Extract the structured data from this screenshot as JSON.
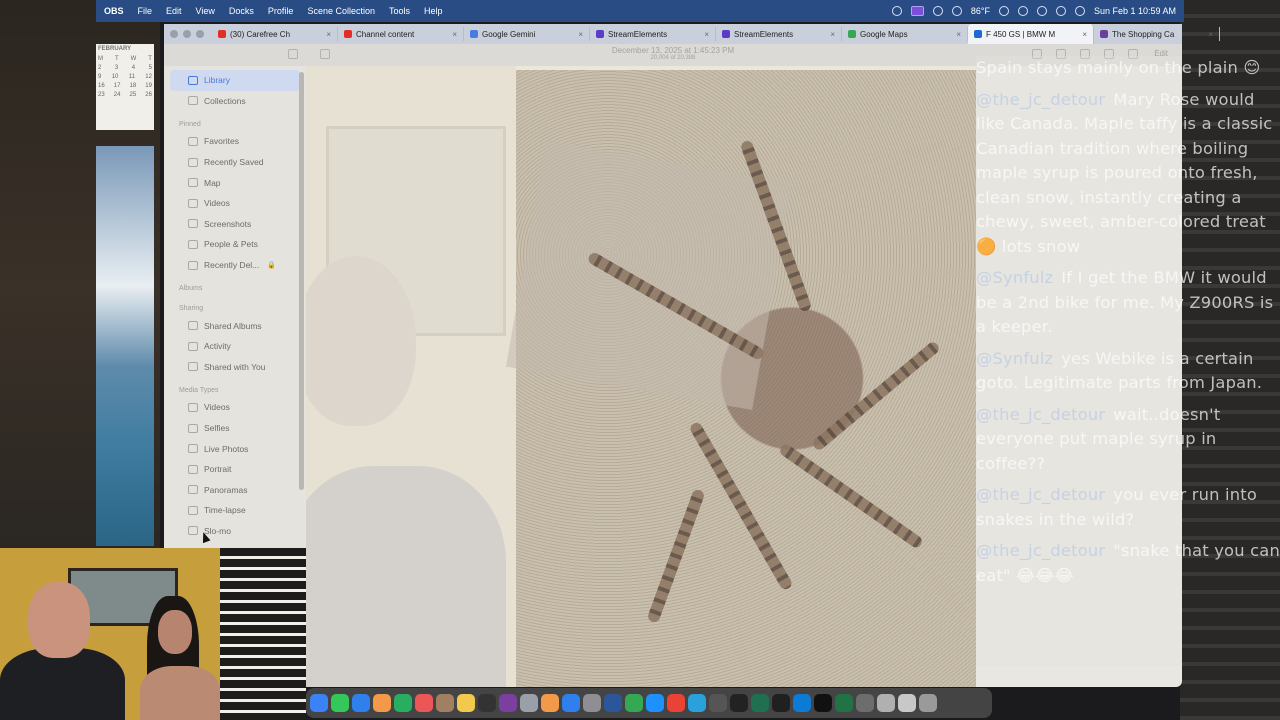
{
  "menubar": {
    "app": "OBS",
    "items": [
      "File",
      "Edit",
      "View",
      "Docks",
      "Profile",
      "Scene Collection",
      "Tools",
      "Help"
    ],
    "weather": "86°F",
    "datetime": "Sun Feb 1  10:59 AM",
    "accent": "#2a4c84"
  },
  "browser": {
    "tabs": [
      {
        "label": "(30) Carefree Ch",
        "icon": "youtube-icon",
        "color": "#e52d27"
      },
      {
        "label": "Channel content",
        "icon": "youtube-icon",
        "color": "#e52d27"
      },
      {
        "label": "Google Gemini",
        "icon": "gemini-icon",
        "color": "#4a7be0"
      },
      {
        "label": "StreamElements",
        "icon": "streamelements-icon",
        "color": "#5b3cc4"
      },
      {
        "label": "StreamElements",
        "icon": "streamelements-icon",
        "color": "#5b3cc4"
      },
      {
        "label": "Google Maps",
        "icon": "maps-icon",
        "color": "#34a853"
      },
      {
        "label": "F 450 GS | BMW M",
        "icon": "bmw-icon",
        "color": "#1c69d4"
      },
      {
        "label": "The Shopping Ca",
        "icon": "shop-icon",
        "color": "#6b3fa0"
      }
    ]
  },
  "photos": {
    "title": "December 13, 2025 at 1:45:23 PM",
    "subtitle": "20,004 of 20,388",
    "edit_label": "Edit",
    "sidebar": {
      "top": [
        {
          "label": "Library",
          "icon": "library-icon",
          "active": true
        },
        {
          "label": "Collections",
          "icon": "collections-icon"
        }
      ],
      "pinned_header": "Pinned",
      "pinned": [
        {
          "label": "Favorites",
          "icon": "heart-icon"
        },
        {
          "label": "Recently Saved",
          "icon": "clock-icon"
        },
        {
          "label": "Map",
          "icon": "map-icon"
        },
        {
          "label": "Videos",
          "icon": "video-icon"
        },
        {
          "label": "Screenshots",
          "icon": "screenshot-icon"
        },
        {
          "label": "People & Pets",
          "icon": "person-icon"
        },
        {
          "label": "Recently Del...",
          "icon": "trash-icon",
          "locked": true
        }
      ],
      "albums_header": "Albums",
      "sharing_header": "Sharing",
      "sharing": [
        {
          "label": "Shared Albums",
          "icon": "shared-albums-icon"
        },
        {
          "label": "Activity",
          "icon": "activity-icon"
        },
        {
          "label": "Shared with You",
          "icon": "shared-with-you-icon"
        }
      ],
      "media_header": "Media Types",
      "media": [
        {
          "label": "Videos",
          "icon": "video-icon"
        },
        {
          "label": "Selfies",
          "icon": "selfie-icon"
        },
        {
          "label": "Live Photos",
          "icon": "live-photo-icon"
        },
        {
          "label": "Portrait",
          "icon": "portrait-icon"
        },
        {
          "label": "Panoramas",
          "icon": "panorama-icon"
        },
        {
          "label": "Time-lapse",
          "icon": "timelapse-icon"
        },
        {
          "label": "Slo-mo",
          "icon": "slomo-icon"
        }
      ]
    }
  },
  "calendar": {
    "month": "FEBRUARY",
    "weekdays": [
      "M",
      "T",
      "W",
      "T"
    ],
    "rows": [
      [
        "2",
        "3",
        "4",
        "5"
      ],
      [
        "9",
        "10",
        "11",
        "12"
      ],
      [
        "16",
        "17",
        "18",
        "19"
      ],
      [
        "23",
        "24",
        "25",
        "26"
      ]
    ]
  },
  "chat": [
    {
      "user": "",
      "text": "Spain stays mainly on the plain 😊"
    },
    {
      "user": "@the_jc_detour",
      "text": "Mary Rose would like Canada. Maple taffy is a classic Canadian tradition where boiling maple syrup is poured onto fresh, clean snow, instantly creating a chewy, sweet, amber-colored treat 🟠 lots snow"
    },
    {
      "user": "@Synfulz",
      "text": "If I get the BMW it would be a 2nd bike for me. My Z900RS is a keeper."
    },
    {
      "user": "@Synfulz",
      "text": "yes Webike is a certain goto. Legitimate parts from Japan."
    },
    {
      "user": "@the_jc_detour",
      "text": "wait..doesn't everyone put maple syrup in coffee??"
    },
    {
      "user": "@the_jc_detour",
      "text": "you ever run into snakes in the wild?"
    },
    {
      "user": "@the_jc_detour",
      "text": "\"snake that you can eat\" 😂😂😂"
    }
  ],
  "dock": [
    {
      "icon": "finder-icon",
      "color": "#3b82f6"
    },
    {
      "icon": "messages-icon",
      "color": "#34c759"
    },
    {
      "icon": "mail-icon",
      "color": "#2f80ed"
    },
    {
      "icon": "photos-icon",
      "color": "#f2994a"
    },
    {
      "icon": "facetime-icon",
      "color": "#27ae60"
    },
    {
      "icon": "calendar-icon",
      "color": "#eb5757"
    },
    {
      "icon": "contacts-icon",
      "color": "#a08060"
    },
    {
      "icon": "notes-icon",
      "color": "#f2c94c"
    },
    {
      "icon": "obs-icon",
      "color": "#333333"
    },
    {
      "icon": "onenote-icon",
      "color": "#7b3fa0"
    },
    {
      "icon": "preview-icon",
      "color": "#9aa0aa"
    },
    {
      "icon": "pages-icon",
      "color": "#f2994a"
    },
    {
      "icon": "appstore-icon",
      "color": "#2f80ed"
    },
    {
      "icon": "settings-icon",
      "color": "#8e8e93"
    },
    {
      "icon": "word-icon",
      "color": "#2b579a"
    },
    {
      "icon": "maps-icon",
      "color": "#34a853"
    },
    {
      "icon": "safari-icon",
      "color": "#1e90ff"
    },
    {
      "icon": "chrome-icon",
      "color": "#ea4335"
    },
    {
      "icon": "telegram-icon",
      "color": "#2aa1da"
    },
    {
      "icon": "camera-icon",
      "color": "#555555"
    },
    {
      "icon": "clapper-icon",
      "color": "#222222"
    },
    {
      "icon": "terminal-icon",
      "color": "#1f6f50"
    },
    {
      "icon": "obs-studio-icon",
      "color": "#202020"
    },
    {
      "icon": "edge-icon",
      "color": "#0c7bd6"
    },
    {
      "icon": "codec-icon",
      "color": "#111111"
    },
    {
      "icon": "excel-icon",
      "color": "#217346"
    },
    {
      "icon": "calculator-icon",
      "color": "#6d6d6d"
    },
    {
      "icon": "folder-icon",
      "color": "#b0b0b0"
    },
    {
      "icon": "stack-icon",
      "color": "#c8c8c8"
    },
    {
      "icon": "trash-icon",
      "color": "#9a9a9a"
    }
  ]
}
